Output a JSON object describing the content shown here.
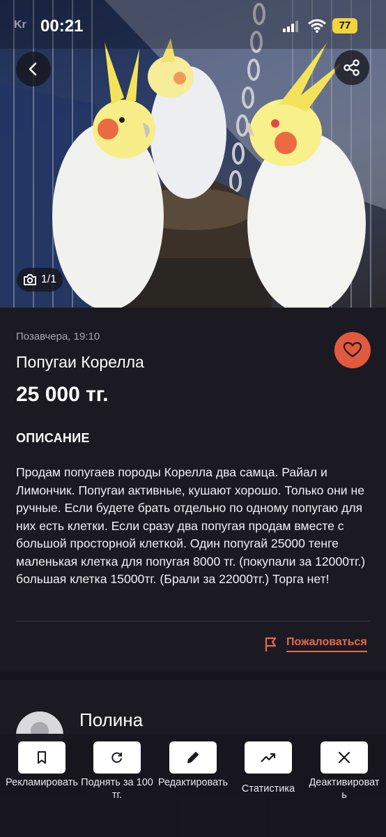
{
  "status_bar": {
    "time": "00:21",
    "brand": "Kr",
    "battery": "77"
  },
  "gallery": {
    "counter": "1/1"
  },
  "listing": {
    "date": "Позавчера, 19:10",
    "title": "Попугаи Корелла",
    "price": "25 000 тг.",
    "description_heading": "ОПИСАНИЕ",
    "description": "Продам попугаев породы Корелла два самца. Райал и Лимончик. Попугаи активные, кушают хорошо. Только они не ручные. Если будете брать отдельно по одному попугаю для них есть клетки. Если сразу два попугая продам вместе с большой просторной клеткой. Один попугай 25000 тенге маленькая клетка для попугая 8000 тг. (покупали за 12000тг.) большая клетка 15000тг. (Брали за 22000тг.) Торга нет!",
    "report_label": "Пожаловаться"
  },
  "seller": {
    "name": "Полина"
  },
  "actions": [
    {
      "label": "Рекламировать",
      "icon": "bookmark-icon"
    },
    {
      "label": "Поднять за 100 тг.",
      "icon": "refresh-icon"
    },
    {
      "label": "Редактировать",
      "icon": "pencil-icon"
    },
    {
      "label": "Статистика",
      "icon": "trend-icon"
    },
    {
      "label": "Деактивировать",
      "icon": "close-icon"
    }
  ],
  "colors": {
    "accent": "#e15a3d",
    "background": "#16151d",
    "card": "#1b1a23"
  }
}
